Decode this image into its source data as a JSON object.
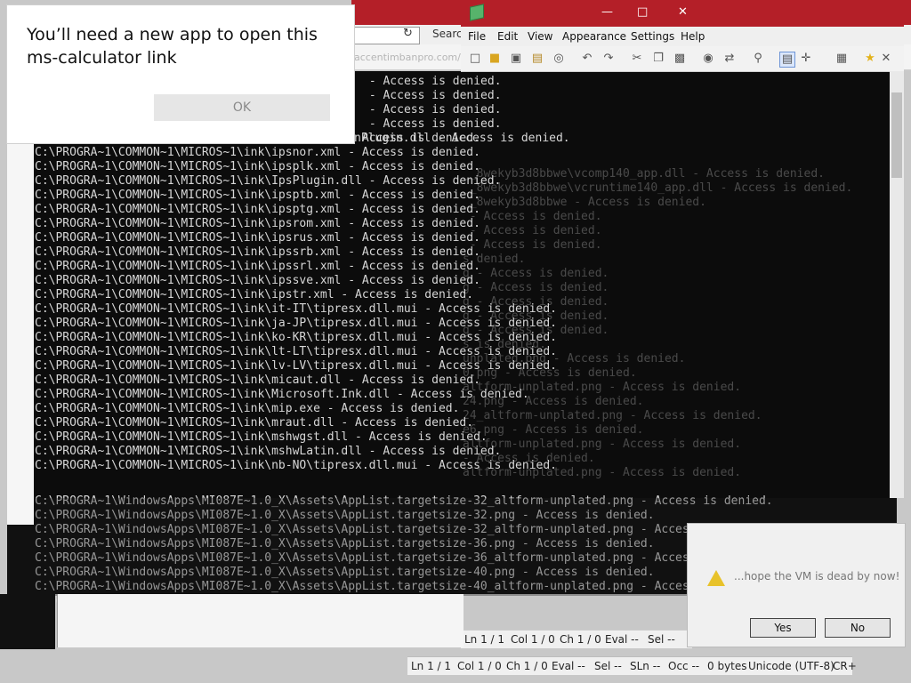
{
  "popup": {
    "title": "You’ll need a new app to open this ms-calculator link",
    "ok_label": "OK"
  },
  "back_window": {
    "search_label": "Search",
    "url_ghost": "accentimbanpro.com/",
    "status": {
      "ln": "Ln  1 / 1",
      "col": "Col  1 / 0",
      "ch": "Ch  1 / 0",
      "eval": "Eval  --",
      "sel": "Sel  --",
      "sln": "SLn  --",
      "occ": "Occ  --",
      "bytes": "0 bytes",
      "encoding": "Unicode (UTF-8)",
      "eol": "CR+"
    }
  },
  "editor": {
    "menu": [
      "File",
      "Edit",
      "View",
      "Appearance",
      "Settings",
      "Help"
    ],
    "status": {
      "ln": "Ln  1 / 1",
      "col": "Col  1 / 0",
      "ch": "Ch  1 / 0",
      "eval": "Eval  --",
      "sel": "Sel  --"
    }
  },
  "console": {
    "top_lines": [
      " - Access is denied.",
      " - Access is denied.",
      " - Access is denied.",
      " - Access is denied.",
      "C:\\PROGRA~1\\COMMON~1\\MICROS~1\\ink\\ipsnld.xml - Access is denied.",
      "C:\\PROGRA~1\\COMMON~1\\MICROS~1\\ink\\ipsnor.xml - Access is denied.",
      "C:\\PROGRA~1\\COMMON~1\\MICROS~1\\ink\\ipsplk.xml - Access is denied.",
      "C:\\PROGRA~1\\COMMON~1\\MICROS~1\\ink\\IpsPlugin.dll - Access is denied.",
      "C:\\PROGRA~1\\COMMON~1\\MICROS~1\\ink\\ipsptb.xml - Access is denied.",
      "C:\\PROGRA~1\\COMMON~1\\MICROS~1\\ink\\ipsptg.xml - Access is denied.",
      "C:\\PROGRA~1\\COMMON~1\\MICROS~1\\ink\\ipsrom.xml - Access is denied.",
      "C:\\PROGRA~1\\COMMON~1\\MICROS~1\\ink\\ipsrus.xml - Access is denied.",
      "C:\\PROGRA~1\\COMMON~1\\MICROS~1\\ink\\ipssrb.xml - Access is denied.",
      "C:\\PROGRA~1\\COMMON~1\\MICROS~1\\ink\\ipssrl.xml - Access is denied.",
      "C:\\PROGRA~1\\COMMON~1\\MICROS~1\\ink\\ipssve.xml - Access is denied.",
      "C:\\PROGRA~1\\COMMON~1\\MICROS~1\\ink\\ipstr.xml - Access is denied.",
      "C:\\PROGRA~1\\COMMON~1\\MICROS~1\\ink\\it-IT\\tipresx.dll.mui - Access is denied.",
      "C:\\PROGRA~1\\COMMON~1\\MICROS~1\\ink\\ja-JP\\tipresx.dll.mui - Access is denied.",
      "C:\\PROGRA~1\\COMMON~1\\MICROS~1\\ink\\ko-KR\\tipresx.dll.mui - Access is denied.",
      "C:\\PROGRA~1\\COMMON~1\\MICROS~1\\ink\\lt-LT\\tipresx.dll.mui - Access is denied.",
      "C:\\PROGRA~1\\COMMON~1\\MICROS~1\\ink\\lv-LV\\tipresx.dll.mui - Access is denied.",
      "C:\\PROGRA~1\\COMMON~1\\MICROS~1\\ink\\micaut.dll - Access is denied.",
      "C:\\PROGRA~1\\COMMON~1\\MICROS~1\\ink\\Microsoft.Ink.dll - Access is denied.",
      "C:\\PROGRA~1\\COMMON~1\\MICROS~1\\ink\\mip.exe - Access is denied.",
      "C:\\PROGRA~1\\COMMON~1\\MICROS~1\\ink\\mraut.dll - Access is denied.",
      "C:\\PROGRA~1\\COMMON~1\\MICROS~1\\ink\\mshwgst.dll - Access is denied.",
      "C:\\PROGRA~1\\COMMON~1\\MICROS~1\\ink\\mshwLatin.dll - Access is denied.",
      "C:\\PROGRA~1\\COMMON~1\\MICROS~1\\ink\\nb-NO\\tipresx.dll.mui - Access is denied."
    ],
    "plugin_line_fragment": "nPlugin.dll - Access is denied.",
    "lower_lines": [
      "C:\\PROGRA~1\\WindowsApps\\MI087E~1.0_X\\Assets\\AppList.targetsize-32_altform-unplated.png - Access is denied.",
      "C:\\PROGRA~1\\WindowsApps\\MI087E~1.0_X\\Assets\\AppList.targetsize-32.png - Access is denied.",
      "C:\\PROGRA~1\\WindowsApps\\MI087E~1.0_X\\Assets\\AppList.targetsize-32_altform-unplated.png - Access is denied.",
      "C:\\PROGRA~1\\WindowsApps\\MI087E~1.0_X\\Assets\\AppList.targetsize-36.png - Access is denied.",
      "C:\\PROGRA~1\\WindowsApps\\MI087E~1.0_X\\Assets\\AppList.targetsize-36_altform-unplated.png - Access is denied.",
      "C:\\PROGRA~1\\WindowsApps\\MI087E~1.0_X\\Assets\\AppList.targetsize-40.png - Access is denied.",
      "C:\\PROGRA~1\\WindowsApps\\MI087E~1.0_X\\Assets\\AppList.targetsize-40_altform-unplated.png - Access is denied.",
      ".png - _"
    ],
    "ghost_lines": [
      "__8wekyb3d8bbwe\\vcomp140_app.dll - Access is denied.",
      "__8wekyb3d8bbwe\\vcruntime140_app.dll - Access is denied.",
      "__8wekyb3d8bbwe - Access is denied.",
      " - Access is denied.",
      " - Access is denied.",
      " - Access is denied.",
      "",
      "s denied.",
      "g - Access is denied.",
      "g - Access is denied.",
      "g - Access is denied.",
      "g - Access is denied.",
      "g - Access is denied.",
      "s is denied.",
      "unplated.png - Access is denied.",
      "0.png - Access is denied.",
      "altform-unplated.png - Access is denied.",
      "24.png - Access is denied.",
      "24_altform-unplated.png - Access is denied.",
      "e6.png - Access is denied.",
      "altform-unplated.png - Access is denied.",
      "- Access is denied.",
      "altform-unplated.png - Access is denied."
    ]
  },
  "message_dialog": {
    "text": "...hope the VM is dead by now!",
    "yes_label": "Yes",
    "no_label": "No"
  },
  "colors": {
    "title_red": "#b41f28",
    "console_bg": "#0c0c0c",
    "console_text": "#d7d7d7"
  }
}
